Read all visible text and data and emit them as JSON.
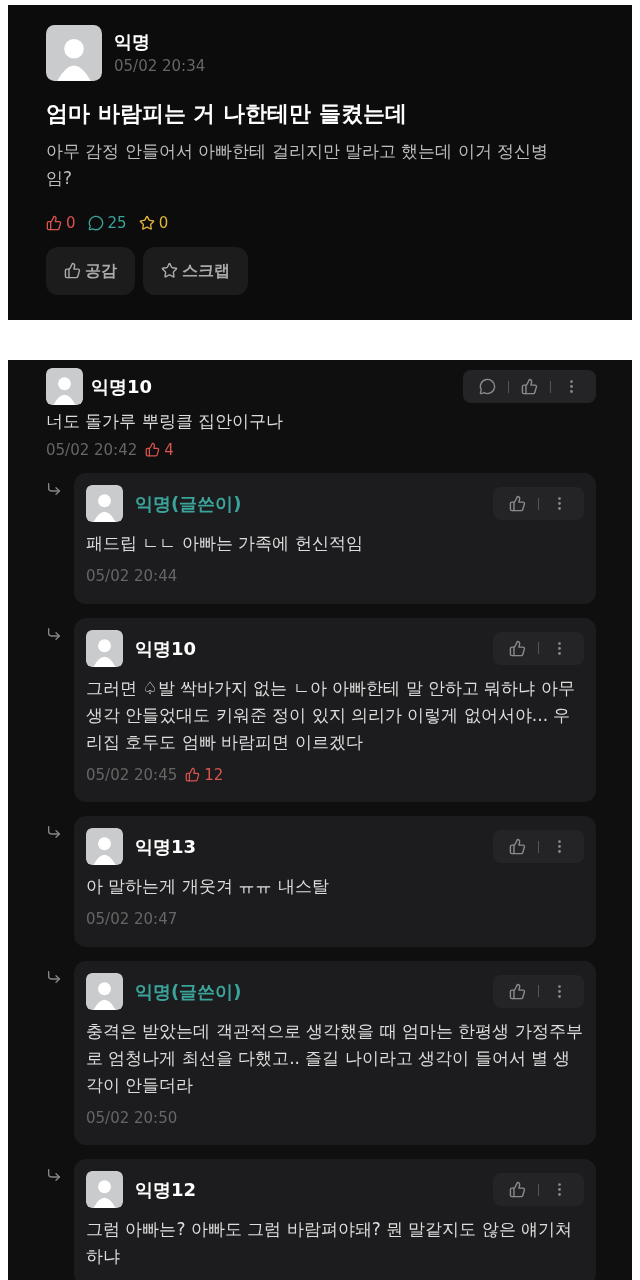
{
  "post": {
    "author": "익명",
    "time": "05/02 20:34",
    "title": "엄마 바람피는 거 나한테만 들켰는데",
    "body": "아무 감정 안들어서 아빠한테 걸리지만 말라고 했는데 이거 정신병임?",
    "stats": [
      {
        "kind": "like",
        "count": "0",
        "color": "#d9534f"
      },
      {
        "kind": "comment",
        "count": "25",
        "color": "#3aa39a"
      },
      {
        "kind": "scrap",
        "count": "0",
        "color": "#e0b43a"
      }
    ],
    "buttons": [
      {
        "kind": "like",
        "label": "공감"
      },
      {
        "kind": "scrap",
        "label": "스크랩"
      }
    ]
  },
  "comments": [
    {
      "author": "익명10",
      "writer": false,
      "text": "너도 돌가루 뿌링클 집안이구나",
      "time": "05/02 20:42",
      "likes": "4",
      "replies": [
        {
          "author": "익명(글쓴이)",
          "writer": true,
          "text": "패드립 ㄴㄴ 아빠는 가족에 헌신적임",
          "time": "05/02 20:44"
        },
        {
          "author": "익명10",
          "writer": false,
          "text": "그러면 ♤발 싹바가지 없는 ㄴ아 아빠한테 말 안하고 뭐하냐 아무 생각 안들었대도 키워준 정이 있지 의리가 이렇게 없어서야... 우리집 호두도 엄빠 바람피면 이르겠다",
          "time": "05/02 20:45",
          "likes": "12"
        },
        {
          "author": "익명13",
          "writer": false,
          "text": "아 말하는게 개웃겨 ㅠㅠ 내스탈",
          "time": "05/02 20:47"
        },
        {
          "author": "익명(글쓴이)",
          "writer": true,
          "text": "충격은 받았는데 객관적으로 생각했을 때 엄마는 한평생 가정주부로 엄청나게 최선을 다했고.. 즐길 나이라고 생각이 들어서 별 생각이 안들더라",
          "time": "05/02 20:50"
        },
        {
          "author": "익명12",
          "writer": false,
          "text": "그럼 아빠는? 아빠도 그럼 바람펴야돼? 뭔 말같지도 않은 얘기쳐하냐"
        }
      ]
    }
  ]
}
